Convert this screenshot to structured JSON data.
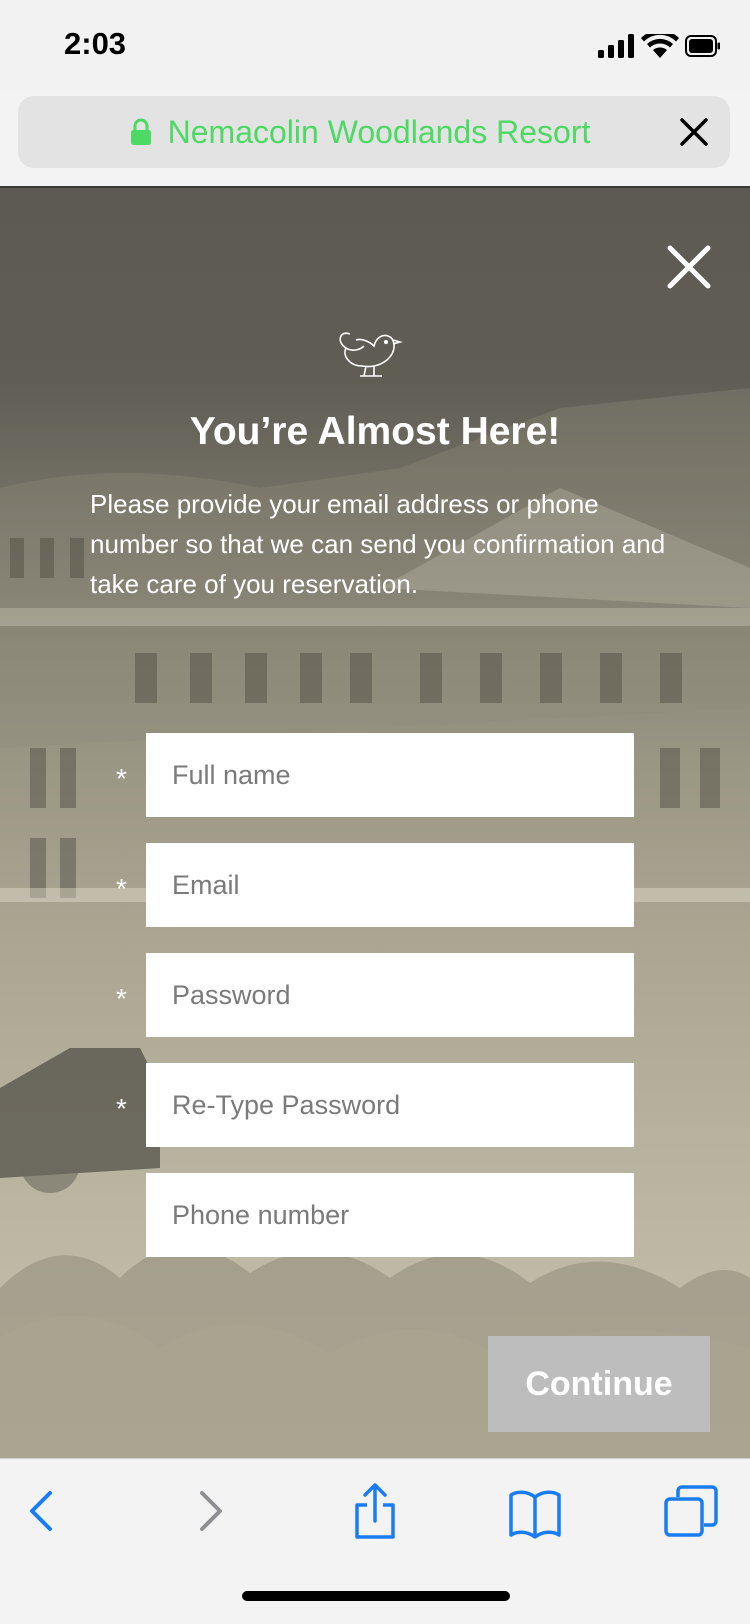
{
  "status_bar": {
    "time": "2:03"
  },
  "address_bar": {
    "site_title": "Nemacolin Woodlands Resort",
    "accent_color": "#4cd964"
  },
  "modal": {
    "title": "You’re Almost Here!",
    "description": "Please provide your email address or phone number so that we can send you confirmation and  take care of you reservation.",
    "fields": [
      {
        "placeholder": "Full name",
        "required_mark": "*"
      },
      {
        "placeholder": "Email",
        "required_mark": "*"
      },
      {
        "placeholder": "Password",
        "required_mark": "*"
      },
      {
        "placeholder": "Re-Type Password",
        "required_mark": "*"
      },
      {
        "placeholder": "Phone number"
      }
    ],
    "continue_label": "Continue"
  },
  "toolbar": {
    "icons": [
      "back-icon",
      "forward-icon",
      "share-icon",
      "bookmarks-icon",
      "tabs-icon"
    ],
    "tint_color": "#1a7cf5"
  }
}
